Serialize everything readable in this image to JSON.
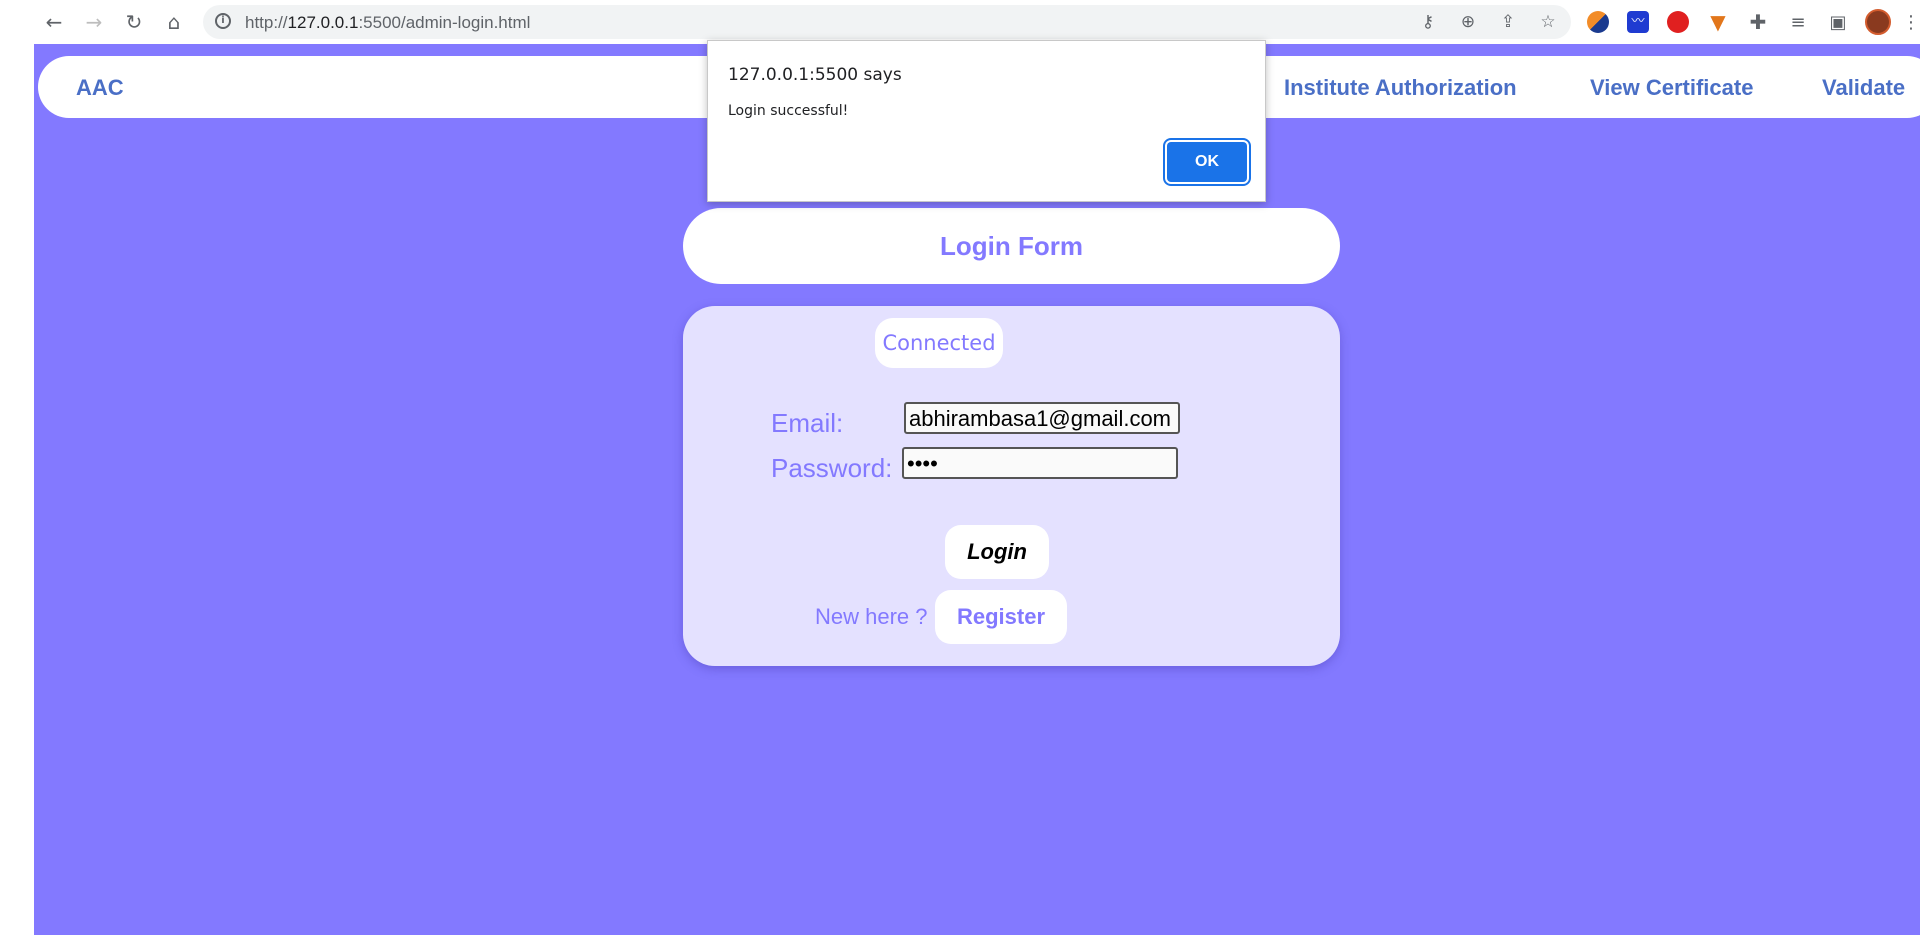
{
  "browser": {
    "url_host": "127.0.0.1",
    "url_rest": ":5500/admin-login.html",
    "url_prefix": "http://",
    "icons": {
      "back": "arrow-left-icon",
      "forward": "arrow-right-icon",
      "reload": "reload-icon",
      "home": "home-icon",
      "site_info": "info-icon",
      "key": "key-icon",
      "zoom": "zoom-icon",
      "share": "share-icon",
      "bookmark": "star-icon"
    },
    "extensions": [
      "extension-orange-blue",
      "extension-wave",
      "extension-red",
      "metamask-fox",
      "puzzle-icon",
      "media-list-icon",
      "side-panel-icon",
      "profile-avatar",
      "more-menu-icon"
    ]
  },
  "navbar": {
    "brand": "AAC",
    "links": [
      "Institute Authorization",
      "View Certificate",
      "Validate"
    ]
  },
  "login": {
    "title": "Login Form",
    "status": "Connected",
    "email_label": "Email:",
    "email_value": "abhirambasa1@gmail.com",
    "password_label": "Password:",
    "password_value": "••••",
    "login_button": "Login",
    "new_here": "New here ?",
    "register_button": "Register"
  },
  "alert": {
    "origin": "127.0.0.1:5500 says",
    "message": "Login successful!",
    "ok_label": "OK"
  },
  "colors": {
    "page_bg": "#8379ff",
    "card_bg": "#e4e1ff",
    "nav_link": "#4a6fc6",
    "accent": "#8379ff",
    "alert_button": "#1a73e8"
  }
}
